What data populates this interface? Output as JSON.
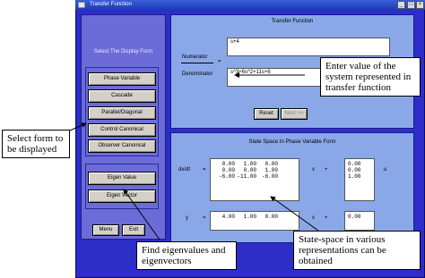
{
  "window": {
    "title": "Transfer Function"
  },
  "left_panel": {
    "heading": "Select The Display Form",
    "form_buttons": [
      "Phase Variable",
      "Cascade",
      "Parallel/Diagonal",
      "Control Canonical",
      "Observer Canonical"
    ],
    "eigen_buttons": [
      "Eigen Value",
      "Eigen Vector"
    ],
    "menu_label": "Menu",
    "exit_label": "Exit"
  },
  "transfer_function": {
    "heading": "Transfer Function",
    "numerator_label": "Numerator",
    "numerator_value": "s+4",
    "denominator_label": "Denominator",
    "denominator_value": "s^3+6s^2+11s+6",
    "equals": "=",
    "reset_label": "Reset",
    "next_label": "Next >>"
  },
  "state_space": {
    "heading": "State Space In Phase Variable Form",
    "dxdt_label": "dx/dt",
    "y_label": "y",
    "equals": "=",
    "x_label": "x",
    "u_label": "u",
    "plus": "+",
    "A": [
      [
        "0.00",
        "1.00",
        "0.00"
      ],
      [
        "0.00",
        "0.00",
        "1.00"
      ],
      [
        "-6.00",
        "-11.00",
        "-6.00"
      ]
    ],
    "B": [
      "0.00",
      "0.00",
      "1.00"
    ],
    "C": [
      "4.00",
      "1.00",
      "0.00"
    ],
    "D": "0.00"
  },
  "annotations": {
    "enter_value": "Enter value of the system represented in transfer function",
    "select_form": "Select form to be displayed",
    "find_eigen": "Find eigenvalues and eigenvectors",
    "state_space_note": "State-space in various representations can be obtained"
  }
}
